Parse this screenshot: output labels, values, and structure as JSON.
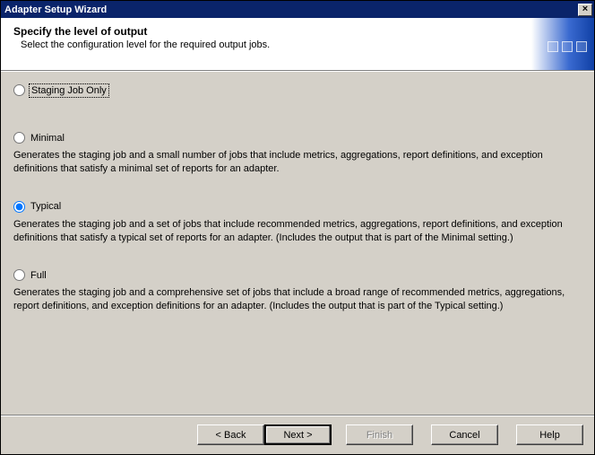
{
  "window": {
    "title": "Adapter Setup Wizard"
  },
  "header": {
    "title": "Specify the level of output",
    "subtitle": "Select the configuration level for the required output jobs."
  },
  "options": {
    "staging": {
      "label": "Staging Job Only"
    },
    "minimal": {
      "label": "Minimal",
      "desc": "Generates the staging job and a small number of jobs that include metrics, aggregations, report definitions, and exception definitions that satisfy a minimal set of reports for an adapter."
    },
    "typical": {
      "label": "Typical",
      "desc": "Generates the staging job and a set of jobs that include recommended metrics, aggregations, report definitions, and exception definitions that satisfy a typical set of reports for an adapter. (Includes the output that is part of the Minimal setting.)"
    },
    "full": {
      "label": "Full",
      "desc": "Generates the staging job and a comprehensive set of jobs that include a broad range of recommended metrics, aggregations, report definitions, and exception definitions for an adapter. (Includes the output that is part of the Typical setting.)"
    },
    "selected": "typical"
  },
  "buttons": {
    "back": "< Back",
    "next": "Next >",
    "finish": "Finish",
    "cancel": "Cancel",
    "help": "Help"
  }
}
